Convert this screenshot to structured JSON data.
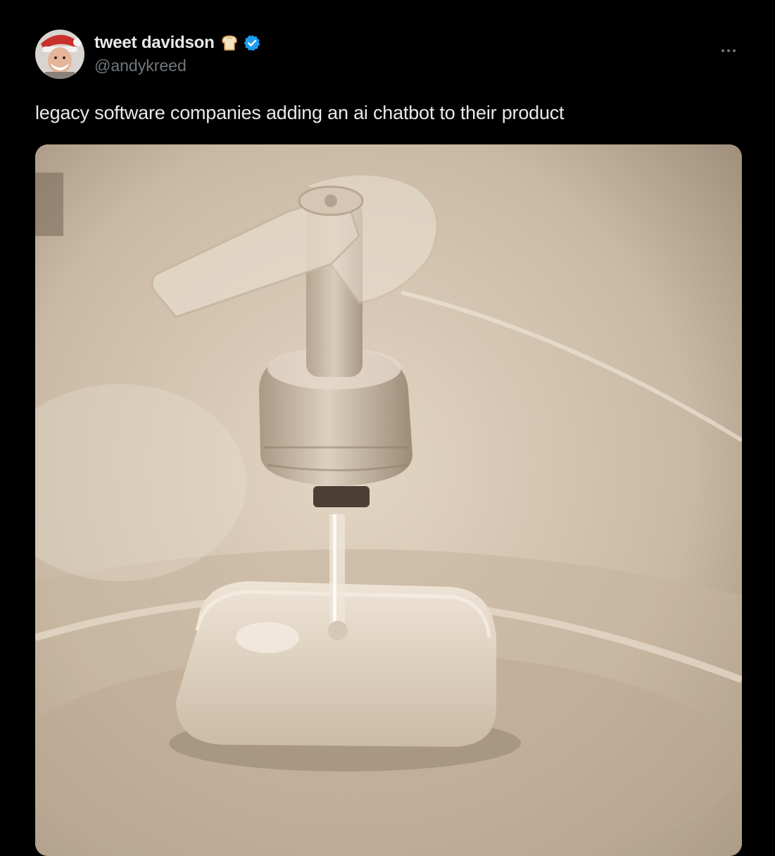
{
  "tweet": {
    "author": {
      "display_name": "tweet davidson",
      "handle": "@andykreed",
      "avatar_icon": "profile-avatar",
      "badge_icons": [
        "bread-emoji-icon",
        "verified-badge-icon"
      ],
      "verified_color": "#1d9bf0"
    },
    "more_icon": "more-options-icon",
    "text": "legacy software companies adding an ai chatbot to their product",
    "media": {
      "type": "photo",
      "palette": [
        "#d8c9b6",
        "#b9aa97",
        "#8c7d6b",
        "#efe6da"
      ]
    }
  }
}
